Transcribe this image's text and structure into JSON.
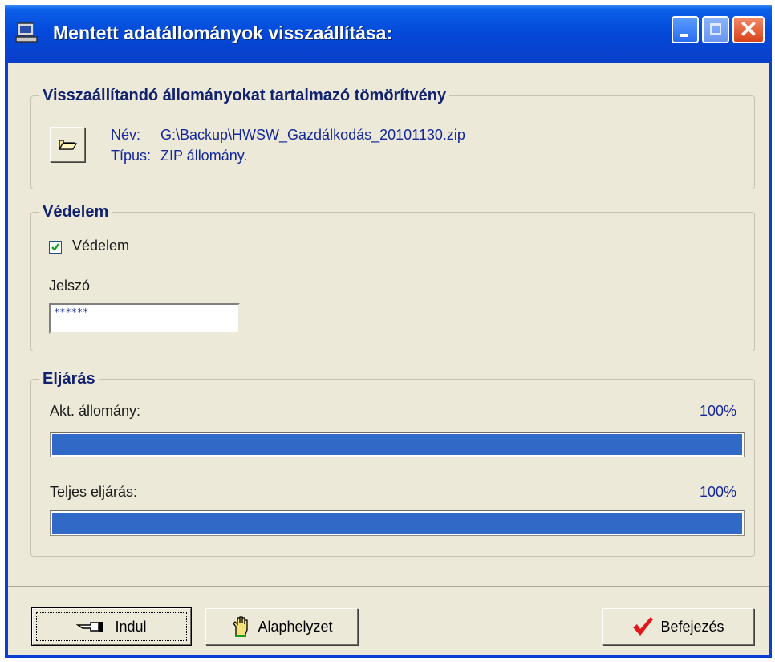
{
  "window": {
    "title": "Mentett adatállományok visszaállítása:",
    "icon": "computer-icon",
    "controls": {
      "minimize": "minimize-icon",
      "maximize": "maximize-icon",
      "close_glyph": "✕"
    }
  },
  "archive_group": {
    "legend": "Visszaállítandó állományokat tartalmazó tömörítvény",
    "browse_icon": "folder-open-icon",
    "name_label": "Név:",
    "name_value": "G:\\Backup\\HWSW_Gazdálkodás_20101130.zip",
    "type_label": "Típus:",
    "type_value": "ZIP állomány."
  },
  "protection_group": {
    "legend": "Védelem",
    "checkbox_label": "Védelem",
    "checkbox_checked": true,
    "password_label": "Jelszó",
    "password_value": "******"
  },
  "process_group": {
    "legend": "Eljárás",
    "current_file_label": "Akt. állomány:",
    "current_file_percent": "100%",
    "current_file_progress": 1.0,
    "total_label": "Teljes eljárás:",
    "total_percent": "100%",
    "total_progress": 1.0
  },
  "buttons": {
    "start_label": "Indul",
    "start_icon": "pointing-hand-icon",
    "reset_label": "Alaphelyzet",
    "reset_icon": "hand-stop-icon",
    "finish_label": "Befejezés",
    "finish_icon": "checkmark-icon"
  },
  "colors": {
    "titlebar": "#0448d9",
    "dialog_bg": "#ece9d8",
    "accent_text": "#14289b",
    "progress_fill": "#3169c6",
    "checkmark": "#e4141b"
  }
}
